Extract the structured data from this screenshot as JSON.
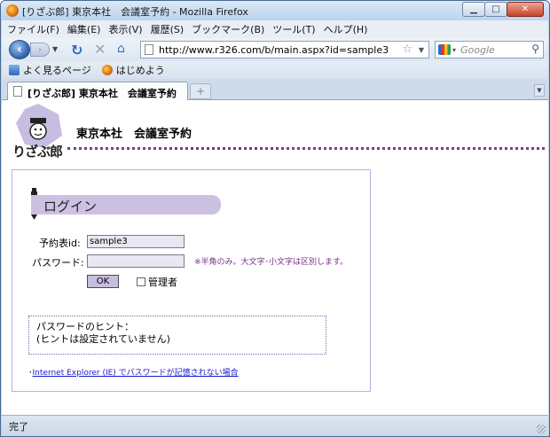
{
  "window": {
    "title": "[りざぶ郎] 東京本社　会議室予約 - Mozilla Firefox"
  },
  "menubar": {
    "items": [
      "ファイル(F)",
      "編集(E)",
      "表示(V)",
      "履歴(S)",
      "ブックマーク(B)",
      "ツール(T)",
      "ヘルプ(H)"
    ]
  },
  "navbar": {
    "url": "http://www.r326.com/b/main.aspx?id=sample3",
    "search_placeholder": "Google"
  },
  "bookmarks": {
    "items": [
      "よく見るページ",
      "はじめよう"
    ]
  },
  "tabs": {
    "active_label": "[りざぶ郎] 東京本社　会議室予約",
    "new_tab": "+"
  },
  "page": {
    "logo_text": "りざぶ郎",
    "site_title": "東京本社　会議室予約",
    "login": {
      "heading": "ログイン",
      "id_label": "予約表id:",
      "id_value": "sample3",
      "password_label": "パスワード:",
      "password_value": "",
      "password_note": "※半角のみ。大文字･小文字は区別します。",
      "ok_label": "OK",
      "admin_label": "管理者"
    },
    "hint": {
      "title": "パスワードのヒント：",
      "body": "(ヒントは設定されていません)"
    },
    "ie_link": {
      "bullet": "･",
      "text": "Internet Explorer (IE) でパスワードが記憶されない場合"
    }
  },
  "status": {
    "text": "完了"
  },
  "colors": {
    "accent_purple": "#7a3d86",
    "header_lavender": "#ccc1e2",
    "border_lavender": "#b8aedf",
    "link_blue": "#1a1ad0"
  }
}
